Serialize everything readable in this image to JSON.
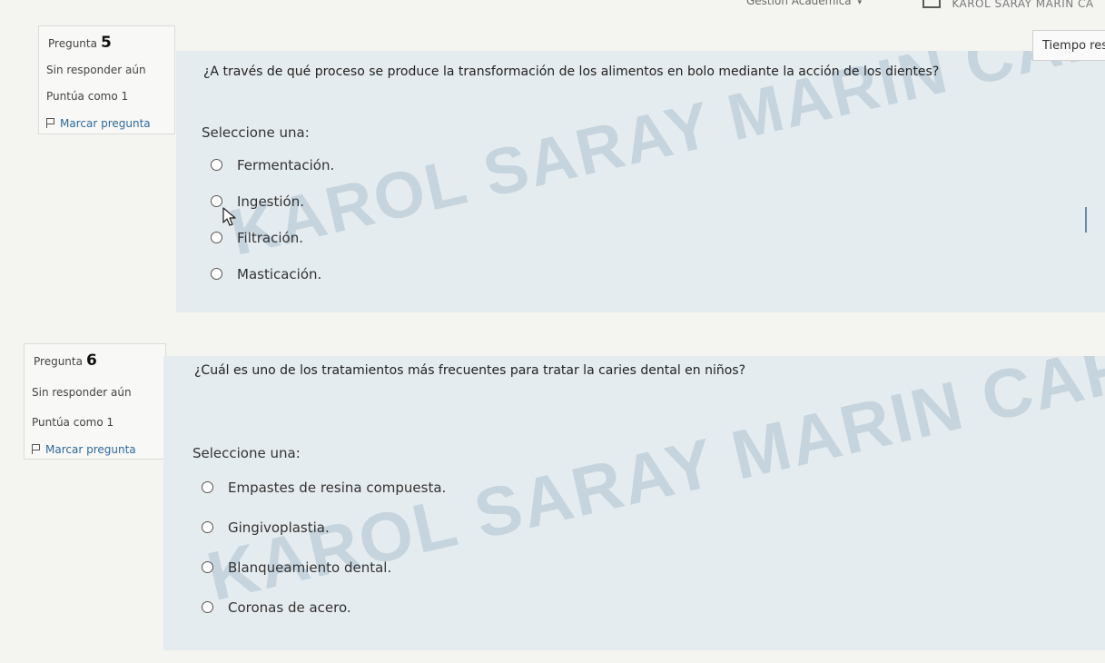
{
  "topbar": {
    "menu_label": "Gestión Académica",
    "menu_caret": "▾",
    "user_name": "KAROL SARAY MARIN CA"
  },
  "timer": {
    "label": "Tiempo res"
  },
  "questions": [
    {
      "number_label": "Pregunta",
      "number": "5",
      "state": "Sin responder aún",
      "grade": "Puntúa como 1",
      "flag_label": "Marcar pregunta",
      "text": "¿A través de qué proceso se produce la transformación de los alimentos en bolo mediante la acción de los dientes?",
      "select_label": "Seleccione una:",
      "answers": [
        "Fermentación.",
        "Ingestión.",
        "Filtración.",
        "Masticación."
      ],
      "watermark": "KAROL SARAY MARIN CARRER"
    },
    {
      "number_label": "Pregunta",
      "number": "6",
      "state": "Sin responder aún",
      "grade": "Puntúa como 1",
      "flag_label": "Marcar pregunta",
      "text": "¿Cuál es uno de los tratamientos más frecuentes para tratar la caries dental en niños?",
      "select_label": "Seleccione una:",
      "answers": [
        "Empastes de resina compuesta.",
        "Gingivoplastia.",
        "Blanqueamiento dental.",
        "Coronas de acero."
      ],
      "watermark": "KAROL SARAY MARIN CARRE"
    }
  ],
  "icons": {
    "flag": "flag-icon",
    "radio": "radio-empty-icon",
    "cursor": "mouse-pointer-icon"
  },
  "colors": {
    "content_bg": "#e5ecef",
    "info_bg": "#f8f8f6",
    "flag_link": "#2f6a99",
    "watermark": "#7896b2"
  }
}
